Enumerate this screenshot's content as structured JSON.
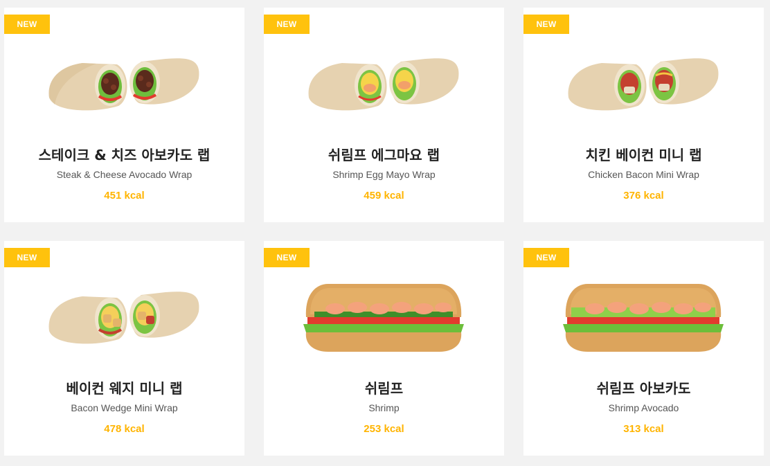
{
  "menu": {
    "items": [
      {
        "badge": "NEW",
        "name_ko": "스테이크 & 치즈 아보카도 랩",
        "name_en": "Steak & Cheese Avocado Wrap",
        "kcal": "451 kcal",
        "image_type": "wrap",
        "filling": "steak"
      },
      {
        "badge": "NEW",
        "name_ko": "쉬림프 에그마요 랩",
        "name_en": "Shrimp Egg Mayo Wrap",
        "kcal": "459 kcal",
        "image_type": "wrap",
        "filling": "egg-shrimp"
      },
      {
        "badge": "NEW",
        "name_ko": "치킨 베이컨 미니 랩",
        "name_en": "Chicken Bacon Mini Wrap",
        "kcal": "376 kcal",
        "image_type": "wrap",
        "filling": "chicken-bacon"
      },
      {
        "badge": "NEW",
        "name_ko": "베이컨 웨지 미니 랩",
        "name_en": "Bacon Wedge Mini Wrap",
        "kcal": "478 kcal",
        "image_type": "wrap",
        "filling": "bacon-wedge"
      },
      {
        "badge": "NEW",
        "name_ko": "쉬림프",
        "name_en": "Shrimp",
        "kcal": "253 kcal",
        "image_type": "sandwich",
        "filling": "shrimp"
      },
      {
        "badge": "NEW",
        "name_ko": "쉬림프 아보카도",
        "name_en": "Shrimp Avocado",
        "kcal": "313 kcal",
        "image_type": "sandwich",
        "filling": "shrimp-avocado"
      }
    ]
  },
  "colors": {
    "background": "#f2f2f2",
    "card": "#ffffff",
    "badge": "#ffc20d",
    "kcal": "#ffb400",
    "title": "#222222",
    "subtitle": "#555555"
  }
}
